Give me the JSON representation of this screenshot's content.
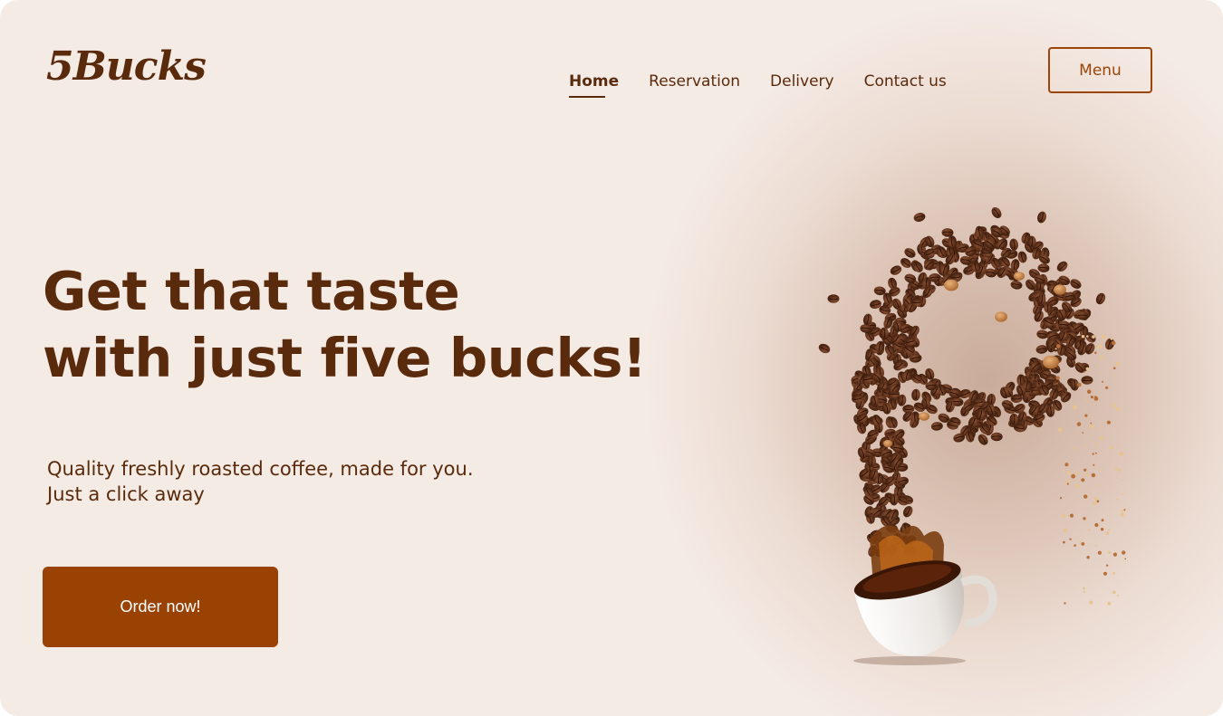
{
  "brand": {
    "logo_text": "5Bucks"
  },
  "nav": {
    "links": [
      {
        "label": "Home",
        "active": true
      },
      {
        "label": "Reservation",
        "active": false
      },
      {
        "label": "Delivery",
        "active": false
      },
      {
        "label": "Contact us",
        "active": false
      }
    ],
    "menu_button_label": "Menu"
  },
  "hero": {
    "headline_line1": "Get that taste",
    "headline_line2": "with just five bucks!",
    "subtext_line1": "Quality freshly roasted coffee, made for you.",
    "subtext_line2": "Just a click away",
    "cta_label": "Order now!"
  },
  "colors": {
    "background": "#f5ebe5",
    "brand_brown": "#5a2a0c",
    "accent": "#9a4204"
  }
}
